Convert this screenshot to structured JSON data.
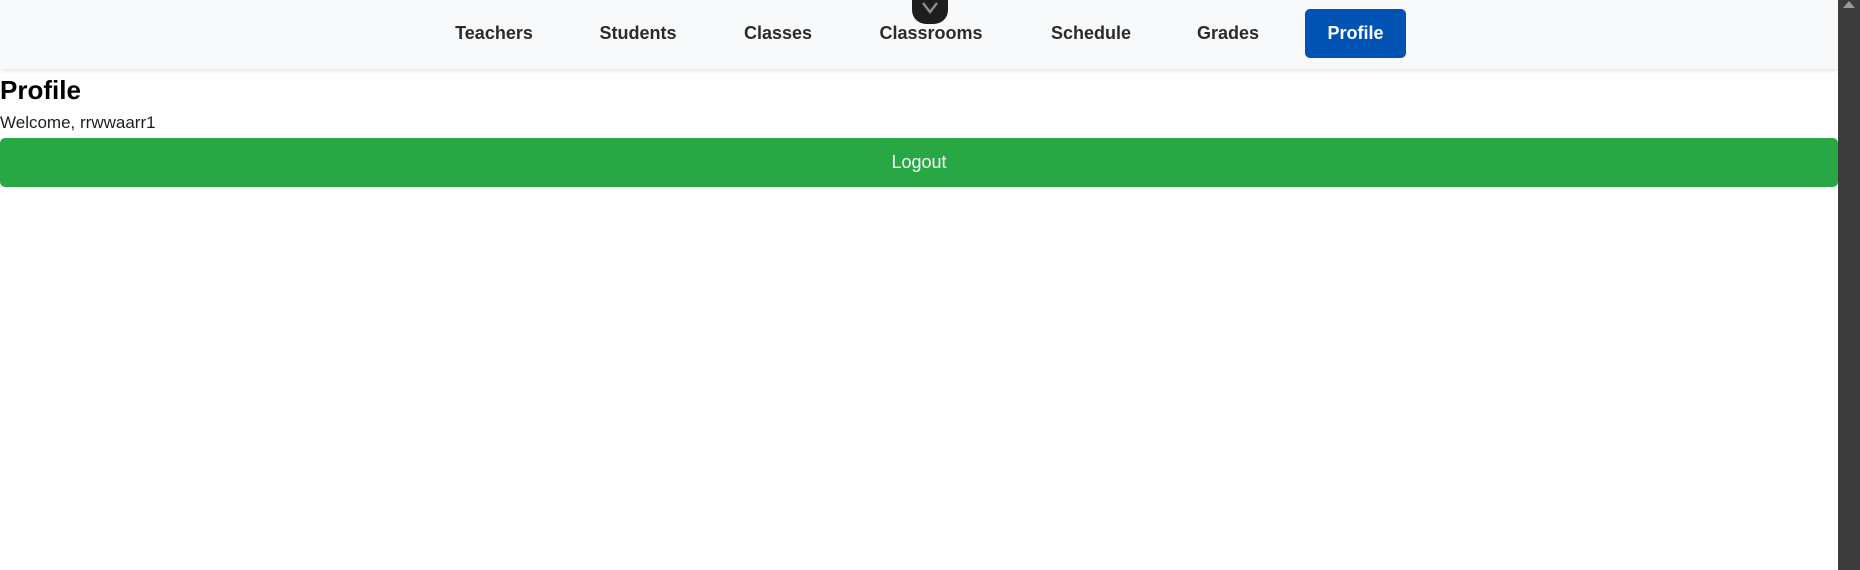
{
  "nav": {
    "items": [
      {
        "label": "Teachers",
        "active": false
      },
      {
        "label": "Students",
        "active": false
      },
      {
        "label": "Classes",
        "active": false
      },
      {
        "label": "Classrooms",
        "active": false
      },
      {
        "label": "Schedule",
        "active": false
      },
      {
        "label": "Grades",
        "active": false
      },
      {
        "label": "Profile",
        "active": true
      }
    ]
  },
  "devtools": {
    "icon": "chevron-down-icon"
  },
  "main": {
    "title": "Profile",
    "welcome_prefix": "Welcome, ",
    "username": "rrwwaarr1",
    "logout_label": "Logout"
  },
  "colors": {
    "nav_background": "#f8f9fa",
    "active_tab": "#0053b3",
    "logout_button": "#28a745",
    "scrollbar": "#3c3c3c"
  }
}
